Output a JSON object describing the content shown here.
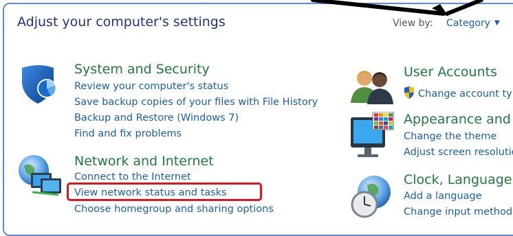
{
  "header": {
    "title": "Adjust your computer's settings",
    "view_by_label": "View by:",
    "view_by_value": "Category"
  },
  "categories": {
    "system_security": {
      "title": "System and Security",
      "links": [
        "Review your computer's status",
        "Save backup copies of your files with File History",
        "Backup and Restore (Windows 7)",
        "Find and fix problems"
      ]
    },
    "network_internet": {
      "title": "Network and Internet",
      "links": [
        "Connect to the Internet",
        "View network status and tasks",
        "Choose homegroup and sharing options"
      ]
    },
    "user_accounts": {
      "title": "User Accounts",
      "links": [
        "Change account ty"
      ]
    },
    "appearance": {
      "title": "Appearance and",
      "links": [
        "Change the theme",
        "Adjust screen resolutio"
      ]
    },
    "clock_language": {
      "title": "Clock, Language,",
      "links": [
        "Add a language",
        "Change input method"
      ]
    }
  },
  "colors": {
    "title": "#1e3287",
    "category_title": "#1f7a3c",
    "link": "#1a5fb4",
    "highlight": "#e0141c",
    "frame": "#5b8bd6"
  }
}
